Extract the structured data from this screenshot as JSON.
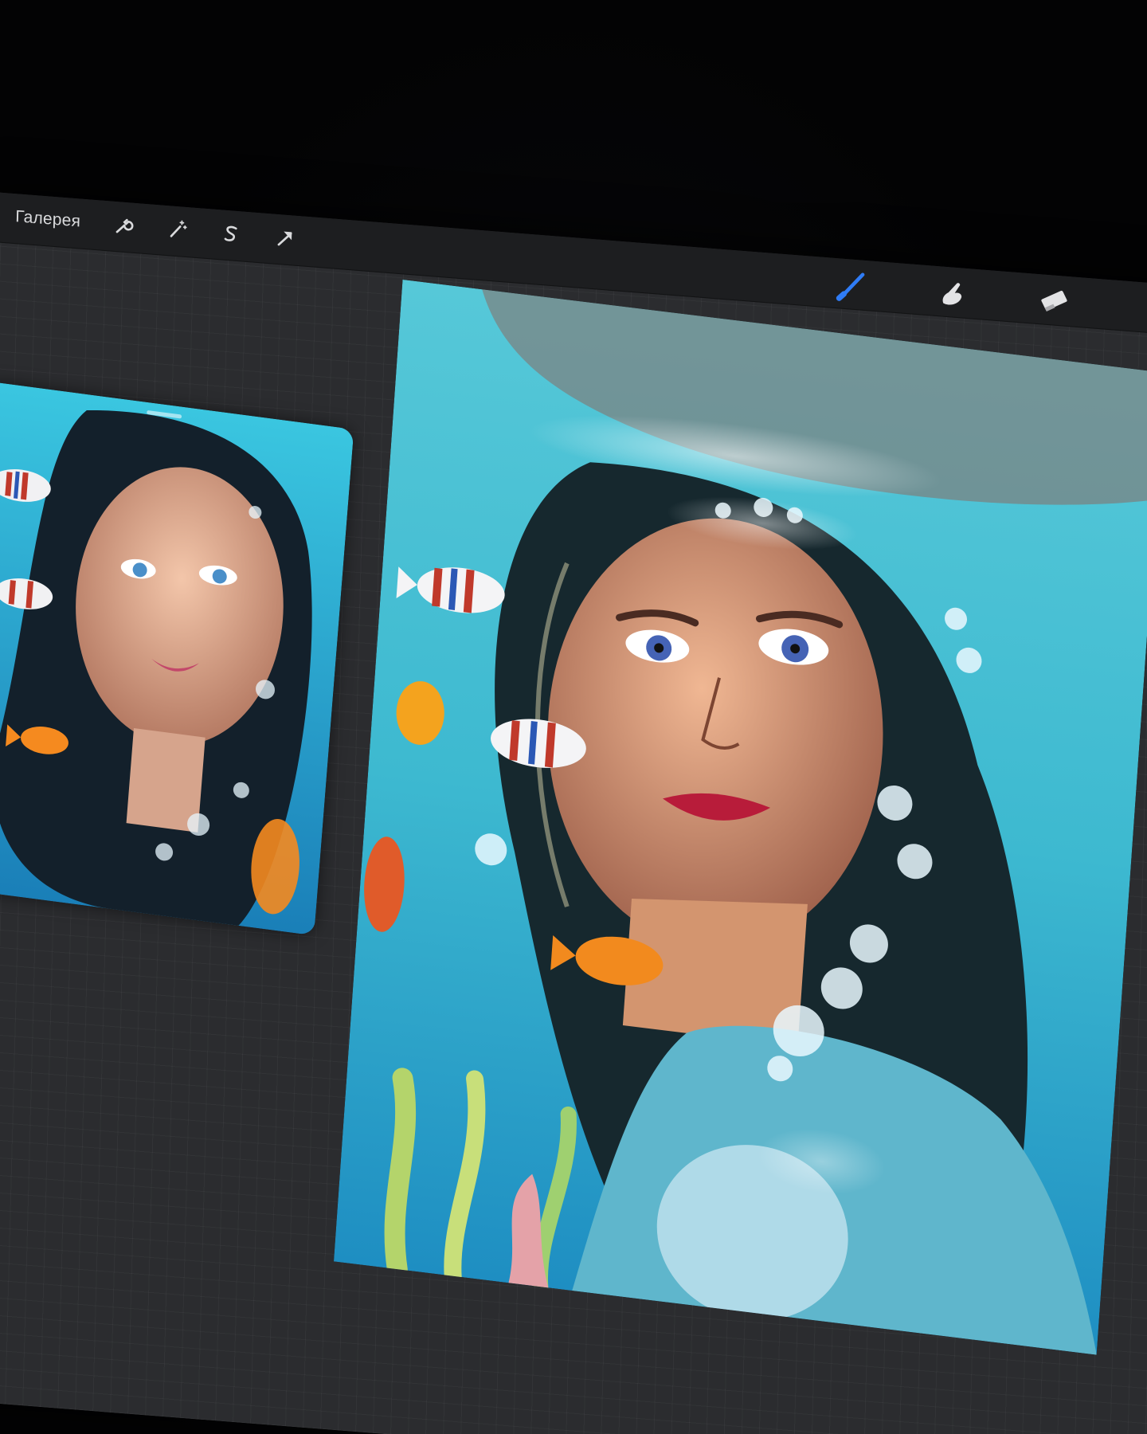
{
  "toolbar": {
    "gallery_label": "Галерея",
    "left_icons": [
      "wrench-icon",
      "magic-wand-icon",
      "selection-s-icon",
      "transform-arrow-icon"
    ],
    "right_icons": [
      "brush-icon",
      "smudge-icon",
      "eraser-icon"
    ],
    "active_tool": "brush",
    "accent_color": "#2f7cf6"
  },
  "reference_panel": {
    "image": "underwater-woman-portrait-reference"
  },
  "canvas": {
    "image": "underwater-woman-portrait-painting"
  }
}
